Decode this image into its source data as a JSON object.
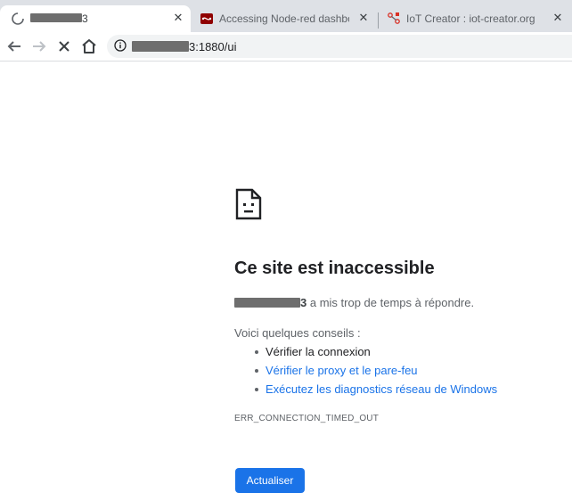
{
  "tabs": [
    {
      "title": "3",
      "icon": "loading-spinner-icon",
      "active": true
    },
    {
      "title": "Accessing Node-red dashboard « ",
      "icon": "node-red-icon",
      "active": false
    },
    {
      "title": "IoT Creator : iot-creator.org",
      "icon": "iot-creator-icon",
      "active": false
    }
  ],
  "tab_close_glyph": "✕",
  "toolbar": {
    "url_suffix": "3:1880/ui"
  },
  "error": {
    "headline": "Ce site est inaccessible",
    "host_suffix": "3",
    "message": " a mis trop de temps à répondre.",
    "tips_title": "Voici quelques conseils :",
    "tips": [
      {
        "text": "Vérifier la connexion",
        "link": false
      },
      {
        "text": "Vérifier le proxy et le pare-feu",
        "link": true
      },
      {
        "text": "Exécutez les diagnostics réseau de Windows",
        "link": true
      }
    ],
    "code": "ERR_CONNECTION_TIMED_OUT",
    "reload_label": "Actualiser"
  },
  "colors": {
    "link": "#1a73e8",
    "button": "#1a73e8",
    "tabstrip": "#dee1e6"
  }
}
